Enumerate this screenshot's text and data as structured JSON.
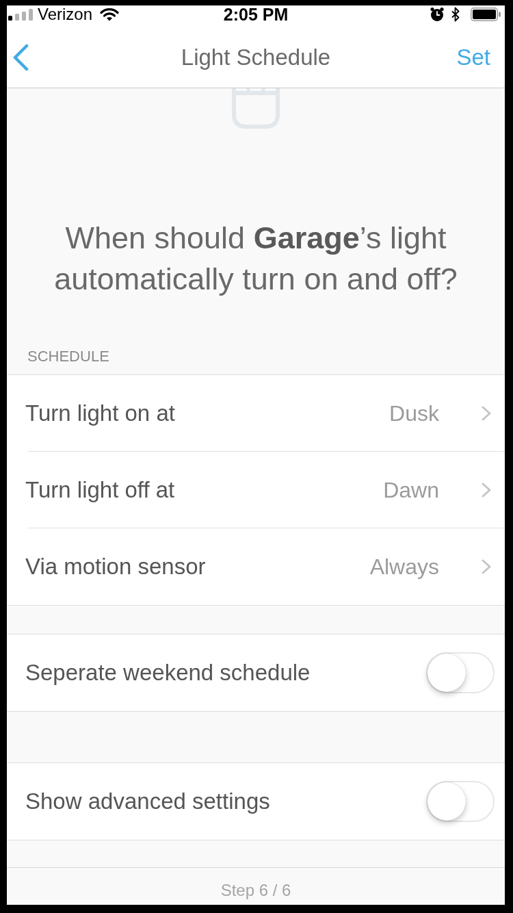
{
  "status_bar": {
    "carrier": "Verizon",
    "time": "2:05 PM"
  },
  "nav": {
    "title": "Light Schedule",
    "action": "Set"
  },
  "prompt": "When should **Garage**’s light automatically turn on and off?",
  "sections": [
    {
      "header": "SCHEDULE",
      "rows": [
        {
          "kind": "link",
          "label": "Turn light on at",
          "value": "Dusk"
        },
        {
          "kind": "link",
          "label": "Turn light off at",
          "value": "Dawn"
        },
        {
          "kind": "link",
          "label": "Via motion sensor",
          "value": "Always"
        }
      ]
    },
    {
      "rows": [
        {
          "kind": "toggle",
          "label": "Seperate weekend schedule",
          "on": false
        }
      ]
    },
    {
      "rows": [
        {
          "kind": "toggle",
          "label": "Show advanced settings",
          "on": false
        }
      ]
    }
  ],
  "footer": "Step 6 / 6"
}
